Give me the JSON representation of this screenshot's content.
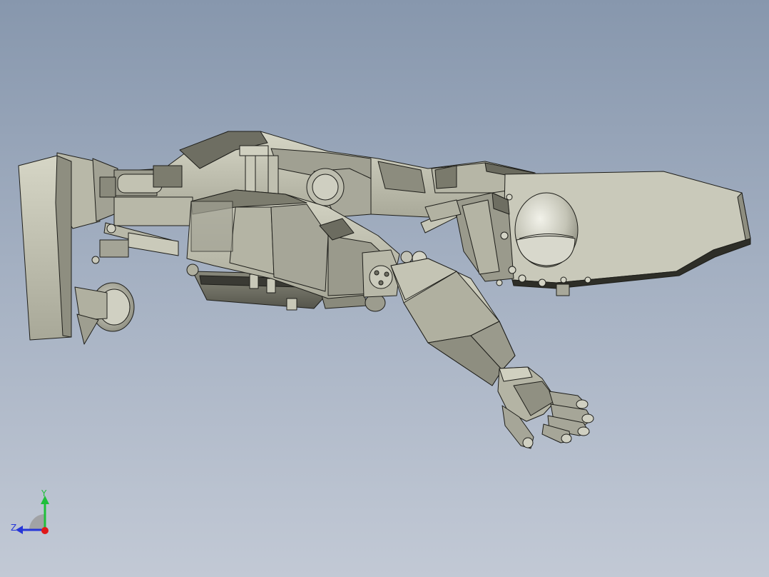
{
  "viewport": {
    "background_top": "#8797ad",
    "background_bottom": "#c2c9d5"
  },
  "model": {
    "body_color": "#c9c9b8",
    "body_dark": "#7c7c6e",
    "body_shadow": "#4a4a42",
    "edge_color": "#1e1e1a"
  },
  "triad": {
    "y_label": "Y",
    "z_label": "Z",
    "y_color": "#1fbf3a",
    "z_color": "#2636d8",
    "x_color": "#e01818",
    "icon": "coordinate-triad-icon"
  }
}
